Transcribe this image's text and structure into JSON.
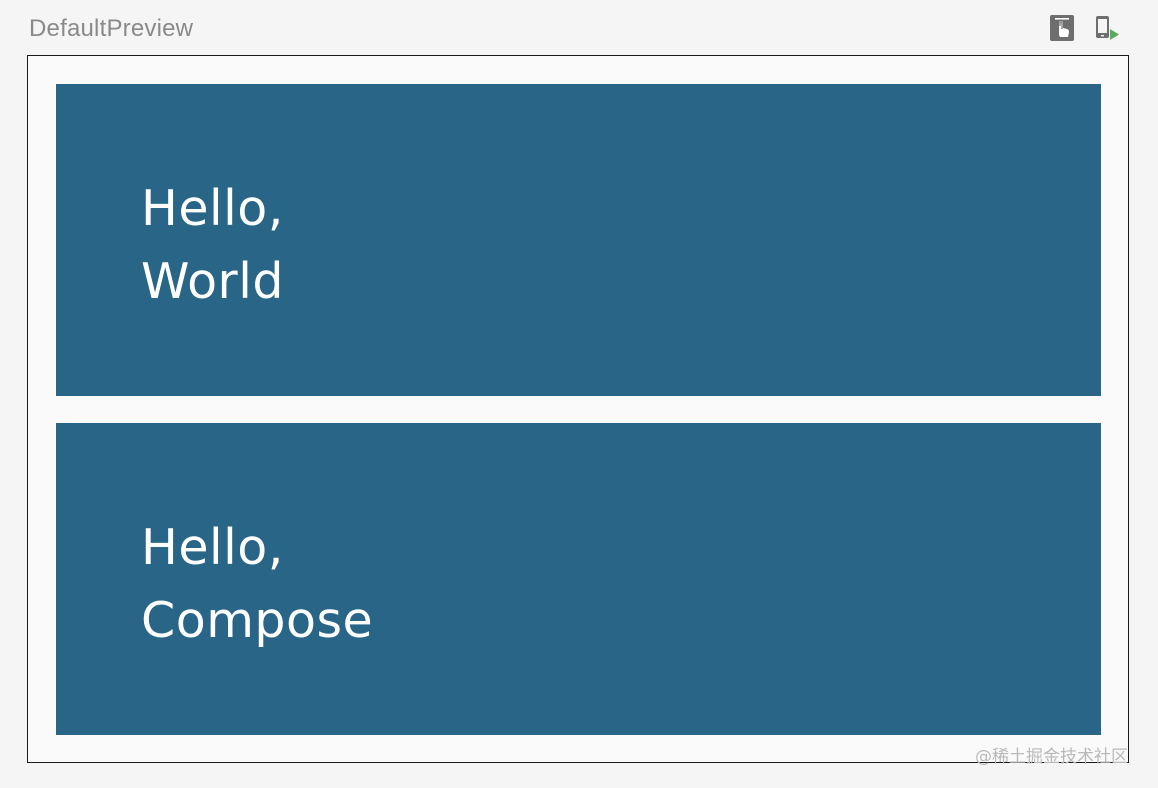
{
  "preview": {
    "title": "DefaultPreview",
    "toolbar": {
      "interactive_icon": "interactive-mode-icon",
      "deploy_icon": "deploy-to-device-icon"
    }
  },
  "cards": [
    {
      "line1": "Hello,",
      "line2": "World"
    },
    {
      "line1": "Hello,",
      "line2": "Compose"
    }
  ],
  "watermark": "@稀土掘金技术社区",
  "colors": {
    "card_background": "#296587",
    "card_text": "#ffffff",
    "page_background": "#f5f5f5",
    "deploy_accent": "#5fa85f"
  }
}
